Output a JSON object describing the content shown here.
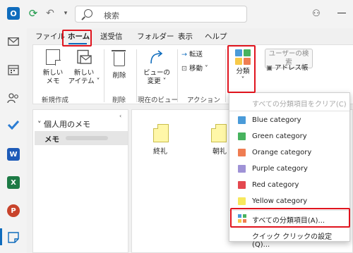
{
  "titlebar": {
    "app_letter": "O",
    "search_placeholder": "検索"
  },
  "rail_tiles": {
    "word": "W",
    "excel": "X",
    "powerpoint": "P"
  },
  "ribbon_tabs": [
    "ファイル",
    "ホーム",
    "送受信",
    "フォルダー",
    "表示",
    "ヘルプ"
  ],
  "ribbon": {
    "new_note_line1": "新しい",
    "new_note_line2": "メモ",
    "new_item_line1": "新しい",
    "new_item_line2": "アイテム ˅",
    "delete_label": "削除",
    "view_change_line1": "ビューの",
    "view_change_line2": "変更 ˅",
    "forward_label": "転送",
    "move_label": "移動 ˅",
    "categorize_label": "分類",
    "categorize_caret": "˅",
    "user_search_label": "ユーザーの検索",
    "address_book_label": "アドレス帳",
    "groups": [
      "新規作成",
      "削除",
      "現在のビュー",
      "アクション"
    ]
  },
  "folder_pane": {
    "section_title": "個人用のメモ",
    "folder_label": "メモ"
  },
  "notes": [
    "終礼",
    "朝礼"
  ],
  "dropdown": {
    "clear_all": "すべての分類項目をクリア(C)",
    "categories": [
      {
        "name": "Blue category",
        "color": "#4a9bd9"
      },
      {
        "name": "Green category",
        "color": "#47b35e"
      },
      {
        "name": "Orange category",
        "color": "#ef7d52"
      },
      {
        "name": "Purple category",
        "color": "#9f92d6"
      },
      {
        "name": "Red category",
        "color": "#e4484f"
      },
      {
        "name": "Yellow category",
        "color": "#f7e85d"
      }
    ],
    "all_categories": "すべての分類項目(A)...",
    "quick_click": "クイック クリックの設定(Q)..."
  },
  "colors": {
    "accent": "#0f6cbd",
    "highlight": "#e0141e"
  }
}
